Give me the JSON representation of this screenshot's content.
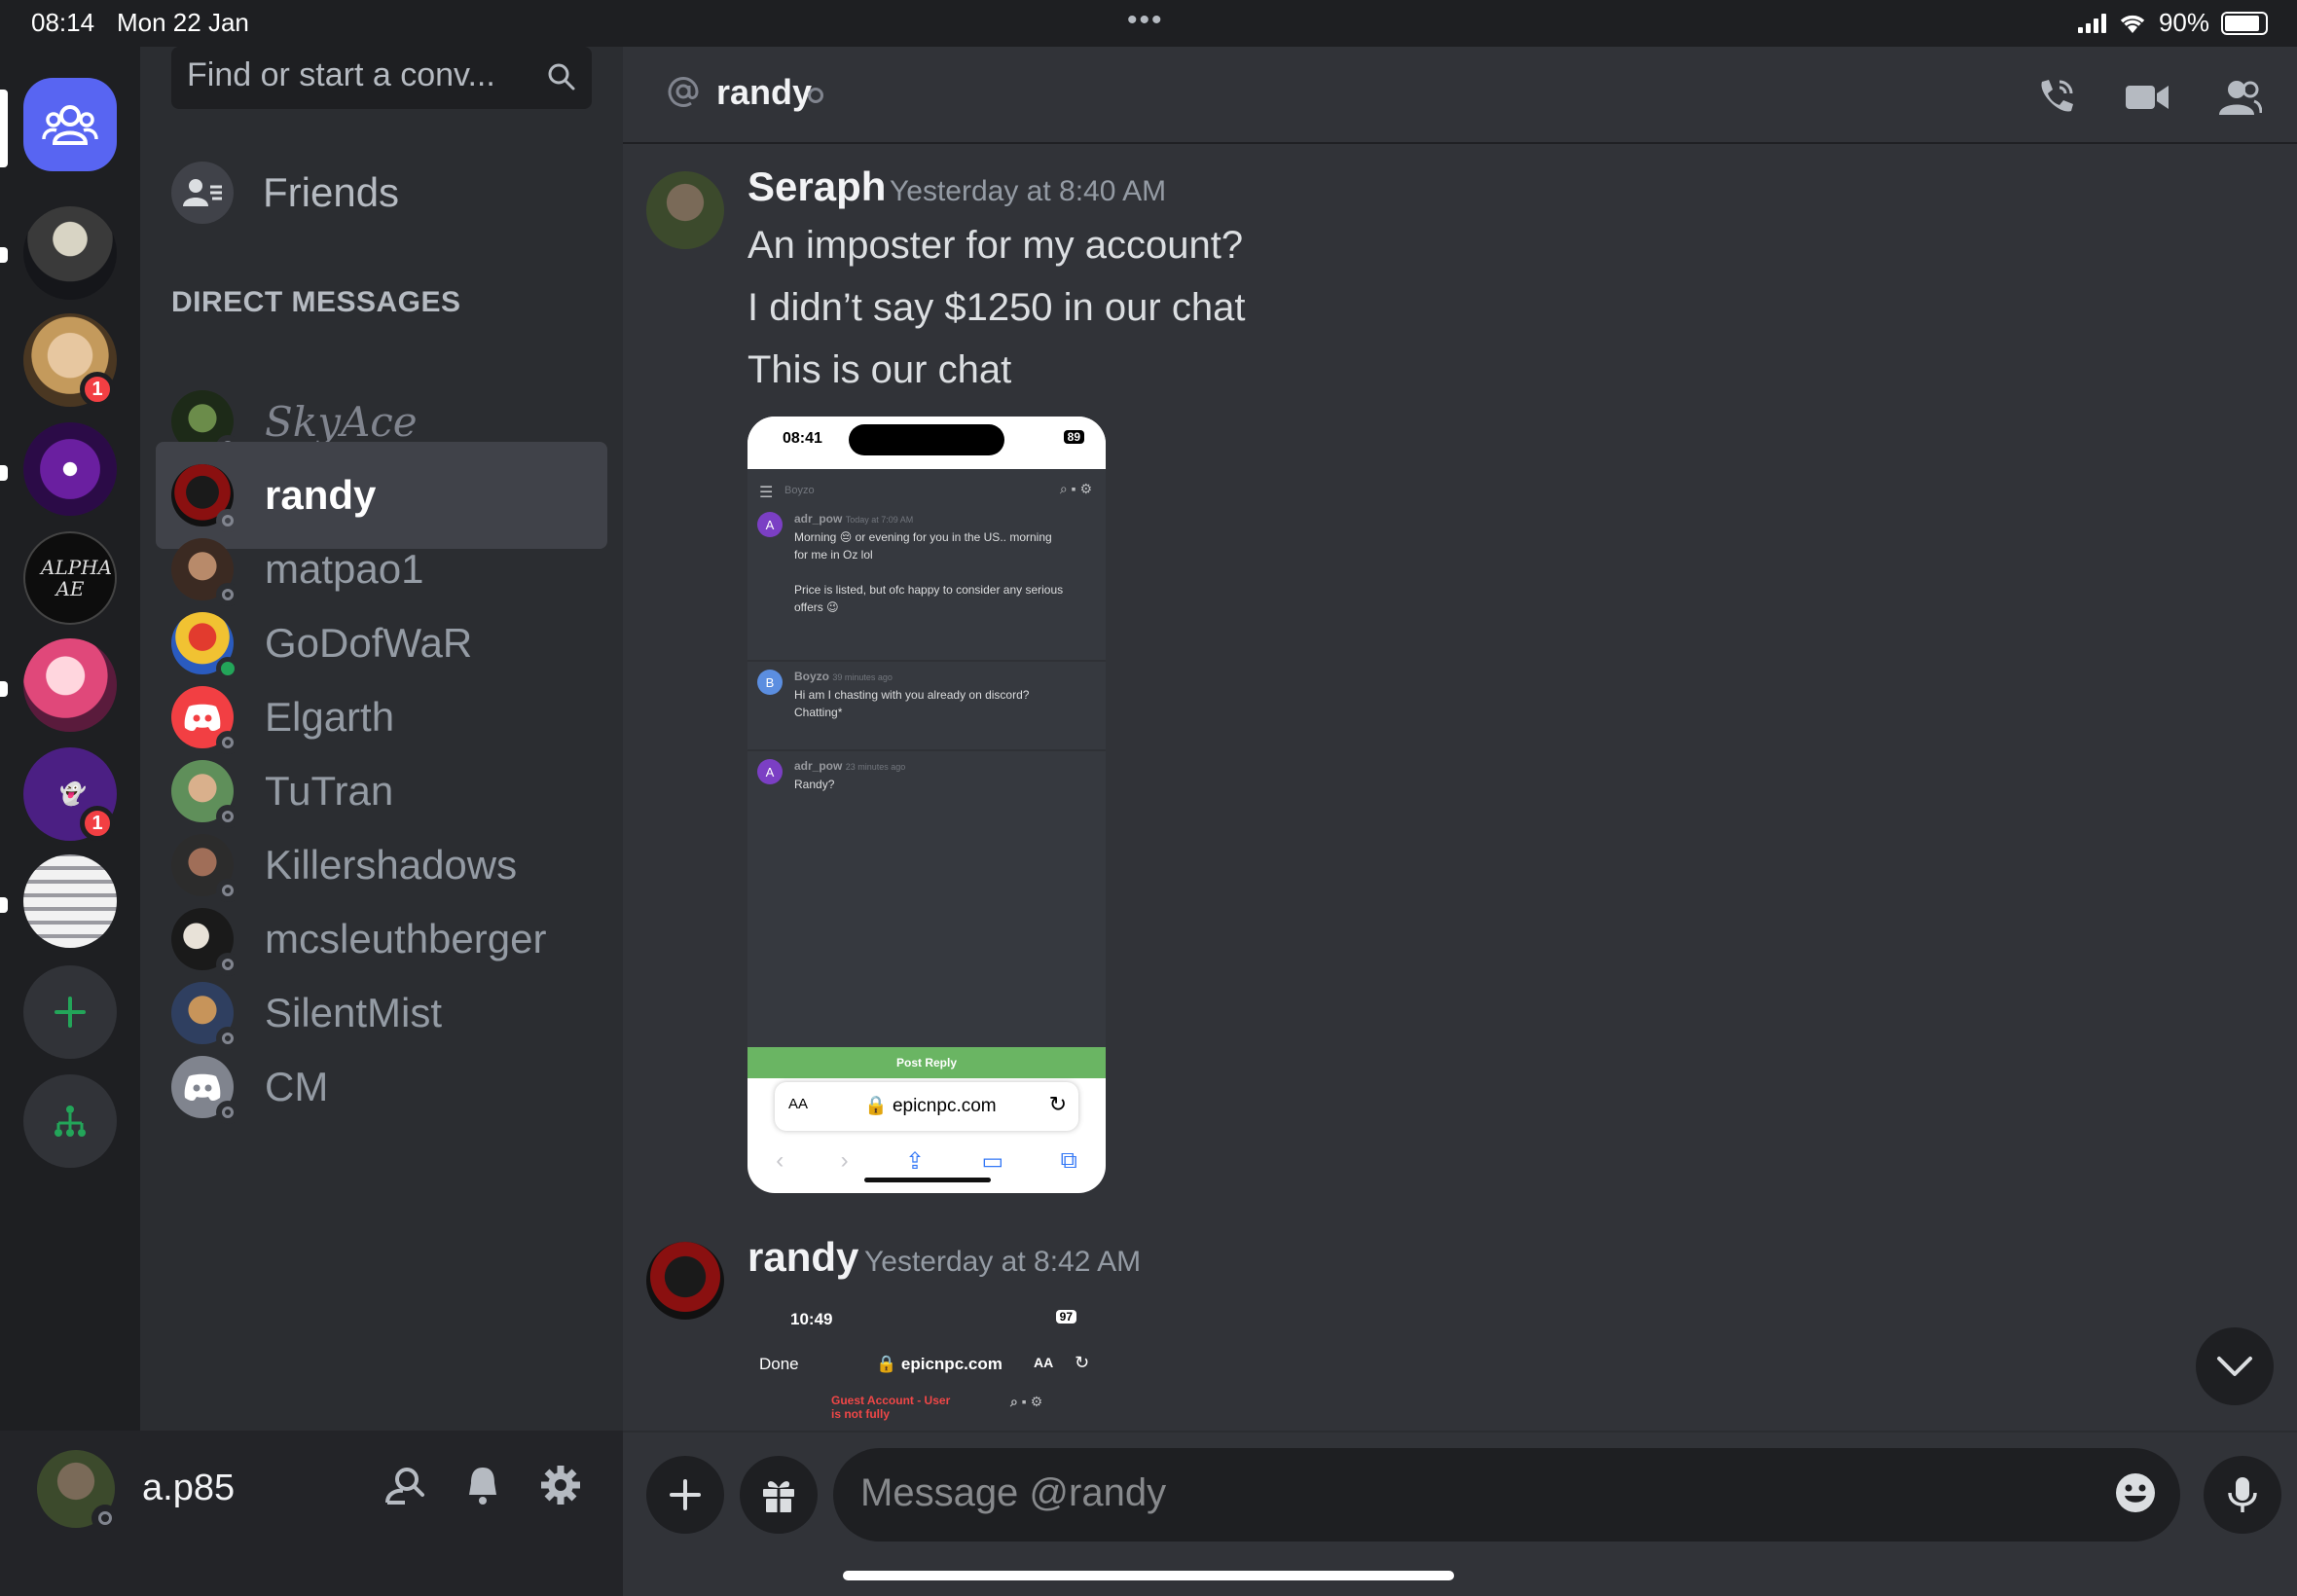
{
  "status_bar": {
    "time": "08:14",
    "date": "Mon 22 Jan",
    "battery": "90%"
  },
  "servers": {
    "badge_1": "1",
    "badge_2": "1",
    "alpha_text": "ALPHA AE"
  },
  "dm_list": {
    "search_placeholder": "Find or start a conv...",
    "friends_label": "Friends",
    "header": "DIRECT MESSAGES",
    "items": [
      {
        "name": "SkyAce"
      },
      {
        "name": "randy"
      },
      {
        "name": "matpao1"
      },
      {
        "name": "GoDofWaR"
      },
      {
        "name": "Elgarth"
      },
      {
        "name": "TuTran"
      },
      {
        "name": "Killershadows"
      },
      {
        "name": "mcsleuthberger"
      },
      {
        "name": "SilentMist"
      },
      {
        "name": "CM"
      }
    ]
  },
  "user_panel": {
    "username": "a.p85"
  },
  "chat": {
    "recipient": "randy",
    "messages": [
      {
        "author": "Seraph",
        "time": "Yesterday at 8:40 AM",
        "lines": [
          "An imposter for my account?",
          "I didn’t say $1250 in our chat",
          "This is our chat"
        ]
      },
      {
        "author": "randy",
        "time": "Yesterday at 8:42 AM"
      }
    ],
    "attachment_1": {
      "time": "08:41",
      "battery": "89",
      "channel": "Boyzo",
      "posts": [
        {
          "initial": "A",
          "user": "adr_pow",
          "time": "Today at 7:09 AM",
          "text1": "Morning",
          "text2": "or evening for you in the US.. morning",
          "text3": "for me in Oz lol",
          "text4": "Price is listed, but ofc happy to consider any serious",
          "text5": "offers"
        },
        {
          "initial": "B",
          "user": "Boyzo",
          "time": "39 minutes ago",
          "text1": "Hi am I chasting with you already on discord?",
          "text2": "Chatting*"
        },
        {
          "initial": "A",
          "user": "adr_pow",
          "time": "23 minutes ago",
          "text1": "Randy?"
        }
      ],
      "reply_button": "Post Reply",
      "url": "epicnpc.com",
      "aa": "AA"
    },
    "attachment_2": {
      "time": "10:49",
      "battery": "97",
      "done": "Done",
      "url": "epicnpc.com",
      "aa": "AA",
      "warning_1": "Guest Account - User",
      "warning_2": "is not fully"
    }
  },
  "composer": {
    "placeholder": "Message @randy"
  },
  "colors": {
    "brand": "#5865f2",
    "background": "#313338",
    "sidebar": "#2b2d31",
    "rail": "#1e1f22",
    "online": "#23a559",
    "badge": "#f23f43"
  }
}
